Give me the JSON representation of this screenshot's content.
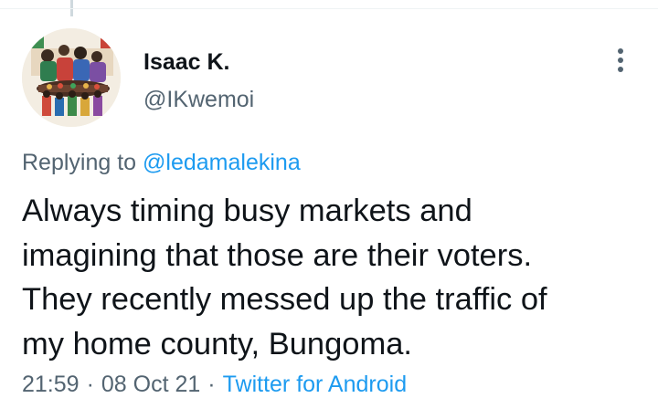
{
  "author": {
    "name": "Isaac K.",
    "handle": "@IKwemoi"
  },
  "reply": {
    "prefix": "Replying to",
    "mention": "@ledamalekina"
  },
  "tweet": {
    "text": "Always timing busy markets and\nimagining that those are their voters.\nThey recently messed up the traffic of\nmy home county, Bungoma."
  },
  "meta": {
    "time": "21:59",
    "separator": "·",
    "date": "08 Oct 21",
    "source": "Twitter for Android"
  },
  "icons": {
    "more": "more-vertical-icon"
  },
  "colors": {
    "text": "#0f1419",
    "secondary": "#536471",
    "link": "#1d9bf0",
    "thread_line": "#cfd9de"
  }
}
